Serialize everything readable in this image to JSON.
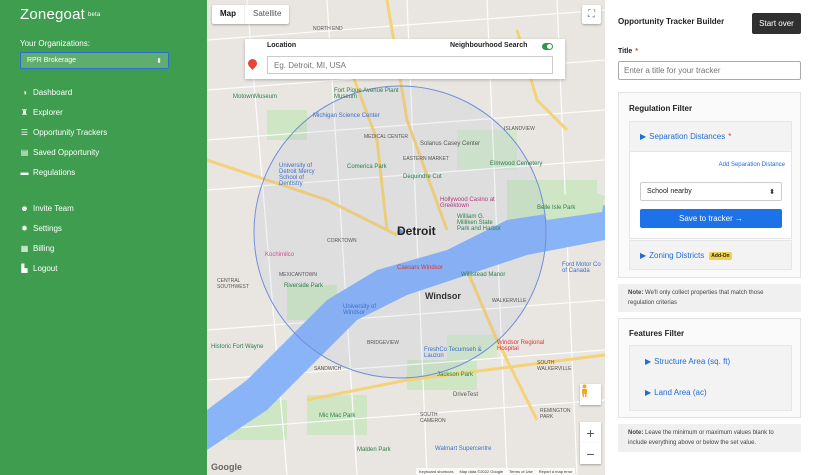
{
  "sidebar": {
    "brand": "Zonegoat",
    "brand_tag": "beta",
    "org_label": "Your Organizations:",
    "org_selected": "RPR Brokerage",
    "nav": [
      {
        "label": "Dashboard",
        "icon": "dashboard-icon"
      },
      {
        "label": "Explorer",
        "icon": "binoculars-icon"
      },
      {
        "label": "Opportunity Trackers",
        "icon": "list-icon"
      },
      {
        "label": "Saved Opportunity",
        "icon": "saved-icon"
      },
      {
        "label": "Regulations",
        "icon": "regulations-icon"
      }
    ],
    "nav2": [
      {
        "label": "Invite Team",
        "icon": "team-icon"
      },
      {
        "label": "Settings",
        "icon": "gear-icon"
      },
      {
        "label": "Billing",
        "icon": "billing-icon"
      },
      {
        "label": "Logout",
        "icon": "logout-icon"
      }
    ]
  },
  "map": {
    "tabs": [
      "Map",
      "Satellite"
    ],
    "location_label": "Location",
    "neighbourhood_label": "Neighbourhood Search",
    "location_placeholder": "Eg. Detroit, MI, USA",
    "footer": [
      "Keyboard shortcuts",
      "Map data ©2022 Google",
      "Terms of Use",
      "Report a map error"
    ],
    "google": "Google",
    "labels": [
      {
        "text": "Detroit",
        "cls": "city"
      },
      {
        "text": "Windsor",
        "cls": "city2"
      },
      {
        "text": "NORTH END"
      },
      {
        "text": "MEDICAL CENTER"
      },
      {
        "text": "EASTERN MARKET"
      },
      {
        "text": "ISLANDVIEW"
      },
      {
        "text": "CORKTOWN"
      },
      {
        "text": "MEXICANTOWN"
      },
      {
        "text": "BRIDGEVIEW"
      },
      {
        "text": "SANDWICH"
      },
      {
        "text": "WALKERVILLE"
      },
      {
        "text": "SOUTH WALKERVILLE"
      },
      {
        "text": "REMINGTON PARK"
      },
      {
        "text": "SOUTH CAMERON"
      },
      {
        "text": "MotownMuseum"
      },
      {
        "text": "Michigan Science Center"
      },
      {
        "text": "Fort Pique Avenue Plant Museum"
      },
      {
        "text": "Comerica Park"
      },
      {
        "text": "Dequindre Cut"
      },
      {
        "text": "Solanus Casey Center"
      },
      {
        "text": "Elmwood Cemetery"
      },
      {
        "text": "Hollywood Casino at Greektown"
      },
      {
        "text": "William G. Milliken State Park and Harbor"
      },
      {
        "text": "Caesars Windsor"
      },
      {
        "text": "Willistead Manor"
      },
      {
        "text": "University of Windsor"
      },
      {
        "text": "FreshCo Tecumseh & Lauzon"
      },
      {
        "text": "Windsor Regional Hospital"
      },
      {
        "text": "Jackson Park"
      },
      {
        "text": "DriveTest"
      },
      {
        "text": "Mic Mac Park"
      },
      {
        "text": "Malden Park"
      },
      {
        "text": "Walmart Supercentre"
      },
      {
        "text": "Riverside Park"
      },
      {
        "text": "Historic Fort Wayne"
      },
      {
        "text": "University of Detroit Mercy School of Dentistry"
      },
      {
        "text": "Belle Isle Park"
      },
      {
        "text": "Ford Motor Co of Canada"
      },
      {
        "text": "CENTRAL SOUTHWEST"
      },
      {
        "text": "Kochimilco"
      }
    ]
  },
  "panel": {
    "title": "Opportunity Tracker Builder",
    "start_over": "Start over",
    "title_label": "Title",
    "title_req": "*",
    "title_placeholder": "Enter a title for your tracker",
    "regulation": {
      "heading": "Regulation Filter",
      "separation": "Separation Distances",
      "separation_req": "*",
      "add_sep": "Add Separation Distance",
      "school": "School nearby",
      "save": "Save to tracker →",
      "zoning": "Zoning Districts",
      "addon": "Add-On"
    },
    "note1_bold": "Note:",
    "note1": "We'll only collect properties that match those regulation criterias",
    "features": {
      "heading": "Features Filter",
      "structure": "Structure Area (sq. ft)",
      "land": "Land Area (ac)"
    },
    "note2_bold": "Note:",
    "note2": "Leave the minimum or maximum values blank to include everything above or below the set value."
  }
}
